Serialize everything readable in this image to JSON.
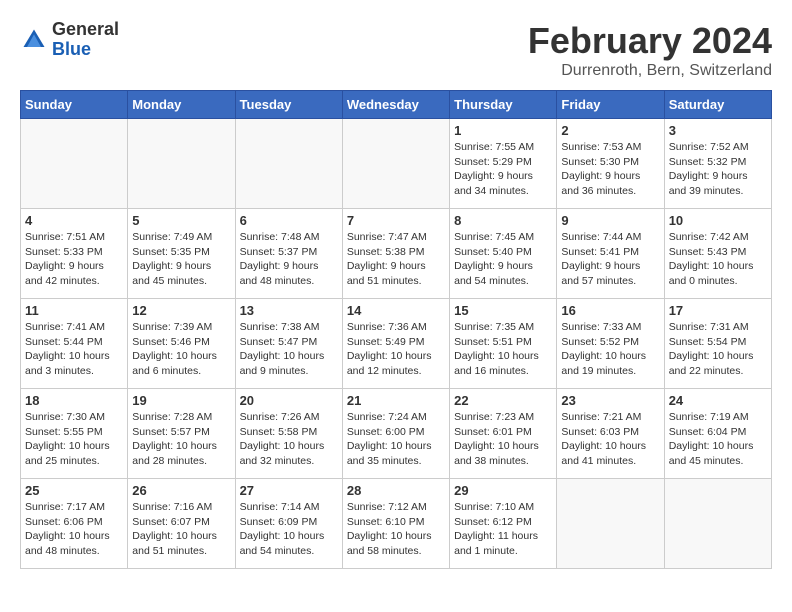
{
  "header": {
    "logo_general": "General",
    "logo_blue": "Blue",
    "month": "February 2024",
    "location": "Durrenroth, Bern, Switzerland"
  },
  "weekdays": [
    "Sunday",
    "Monday",
    "Tuesday",
    "Wednesday",
    "Thursday",
    "Friday",
    "Saturday"
  ],
  "weeks": [
    [
      {
        "day": "",
        "info": ""
      },
      {
        "day": "",
        "info": ""
      },
      {
        "day": "",
        "info": ""
      },
      {
        "day": "",
        "info": ""
      },
      {
        "day": "1",
        "info": "Sunrise: 7:55 AM\nSunset: 5:29 PM\nDaylight: 9 hours\nand 34 minutes."
      },
      {
        "day": "2",
        "info": "Sunrise: 7:53 AM\nSunset: 5:30 PM\nDaylight: 9 hours\nand 36 minutes."
      },
      {
        "day": "3",
        "info": "Sunrise: 7:52 AM\nSunset: 5:32 PM\nDaylight: 9 hours\nand 39 minutes."
      }
    ],
    [
      {
        "day": "4",
        "info": "Sunrise: 7:51 AM\nSunset: 5:33 PM\nDaylight: 9 hours\nand 42 minutes."
      },
      {
        "day": "5",
        "info": "Sunrise: 7:49 AM\nSunset: 5:35 PM\nDaylight: 9 hours\nand 45 minutes."
      },
      {
        "day": "6",
        "info": "Sunrise: 7:48 AM\nSunset: 5:37 PM\nDaylight: 9 hours\nand 48 minutes."
      },
      {
        "day": "7",
        "info": "Sunrise: 7:47 AM\nSunset: 5:38 PM\nDaylight: 9 hours\nand 51 minutes."
      },
      {
        "day": "8",
        "info": "Sunrise: 7:45 AM\nSunset: 5:40 PM\nDaylight: 9 hours\nand 54 minutes."
      },
      {
        "day": "9",
        "info": "Sunrise: 7:44 AM\nSunset: 5:41 PM\nDaylight: 9 hours\nand 57 minutes."
      },
      {
        "day": "10",
        "info": "Sunrise: 7:42 AM\nSunset: 5:43 PM\nDaylight: 10 hours\nand 0 minutes."
      }
    ],
    [
      {
        "day": "11",
        "info": "Sunrise: 7:41 AM\nSunset: 5:44 PM\nDaylight: 10 hours\nand 3 minutes."
      },
      {
        "day": "12",
        "info": "Sunrise: 7:39 AM\nSunset: 5:46 PM\nDaylight: 10 hours\nand 6 minutes."
      },
      {
        "day": "13",
        "info": "Sunrise: 7:38 AM\nSunset: 5:47 PM\nDaylight: 10 hours\nand 9 minutes."
      },
      {
        "day": "14",
        "info": "Sunrise: 7:36 AM\nSunset: 5:49 PM\nDaylight: 10 hours\nand 12 minutes."
      },
      {
        "day": "15",
        "info": "Sunrise: 7:35 AM\nSunset: 5:51 PM\nDaylight: 10 hours\nand 16 minutes."
      },
      {
        "day": "16",
        "info": "Sunrise: 7:33 AM\nSunset: 5:52 PM\nDaylight: 10 hours\nand 19 minutes."
      },
      {
        "day": "17",
        "info": "Sunrise: 7:31 AM\nSunset: 5:54 PM\nDaylight: 10 hours\nand 22 minutes."
      }
    ],
    [
      {
        "day": "18",
        "info": "Sunrise: 7:30 AM\nSunset: 5:55 PM\nDaylight: 10 hours\nand 25 minutes."
      },
      {
        "day": "19",
        "info": "Sunrise: 7:28 AM\nSunset: 5:57 PM\nDaylight: 10 hours\nand 28 minutes."
      },
      {
        "day": "20",
        "info": "Sunrise: 7:26 AM\nSunset: 5:58 PM\nDaylight: 10 hours\nand 32 minutes."
      },
      {
        "day": "21",
        "info": "Sunrise: 7:24 AM\nSunset: 6:00 PM\nDaylight: 10 hours\nand 35 minutes."
      },
      {
        "day": "22",
        "info": "Sunrise: 7:23 AM\nSunset: 6:01 PM\nDaylight: 10 hours\nand 38 minutes."
      },
      {
        "day": "23",
        "info": "Sunrise: 7:21 AM\nSunset: 6:03 PM\nDaylight: 10 hours\nand 41 minutes."
      },
      {
        "day": "24",
        "info": "Sunrise: 7:19 AM\nSunset: 6:04 PM\nDaylight: 10 hours\nand 45 minutes."
      }
    ],
    [
      {
        "day": "25",
        "info": "Sunrise: 7:17 AM\nSunset: 6:06 PM\nDaylight: 10 hours\nand 48 minutes."
      },
      {
        "day": "26",
        "info": "Sunrise: 7:16 AM\nSunset: 6:07 PM\nDaylight: 10 hours\nand 51 minutes."
      },
      {
        "day": "27",
        "info": "Sunrise: 7:14 AM\nSunset: 6:09 PM\nDaylight: 10 hours\nand 54 minutes."
      },
      {
        "day": "28",
        "info": "Sunrise: 7:12 AM\nSunset: 6:10 PM\nDaylight: 10 hours\nand 58 minutes."
      },
      {
        "day": "29",
        "info": "Sunrise: 7:10 AM\nSunset: 6:12 PM\nDaylight: 11 hours\nand 1 minute."
      },
      {
        "day": "",
        "info": ""
      },
      {
        "day": "",
        "info": ""
      }
    ]
  ]
}
